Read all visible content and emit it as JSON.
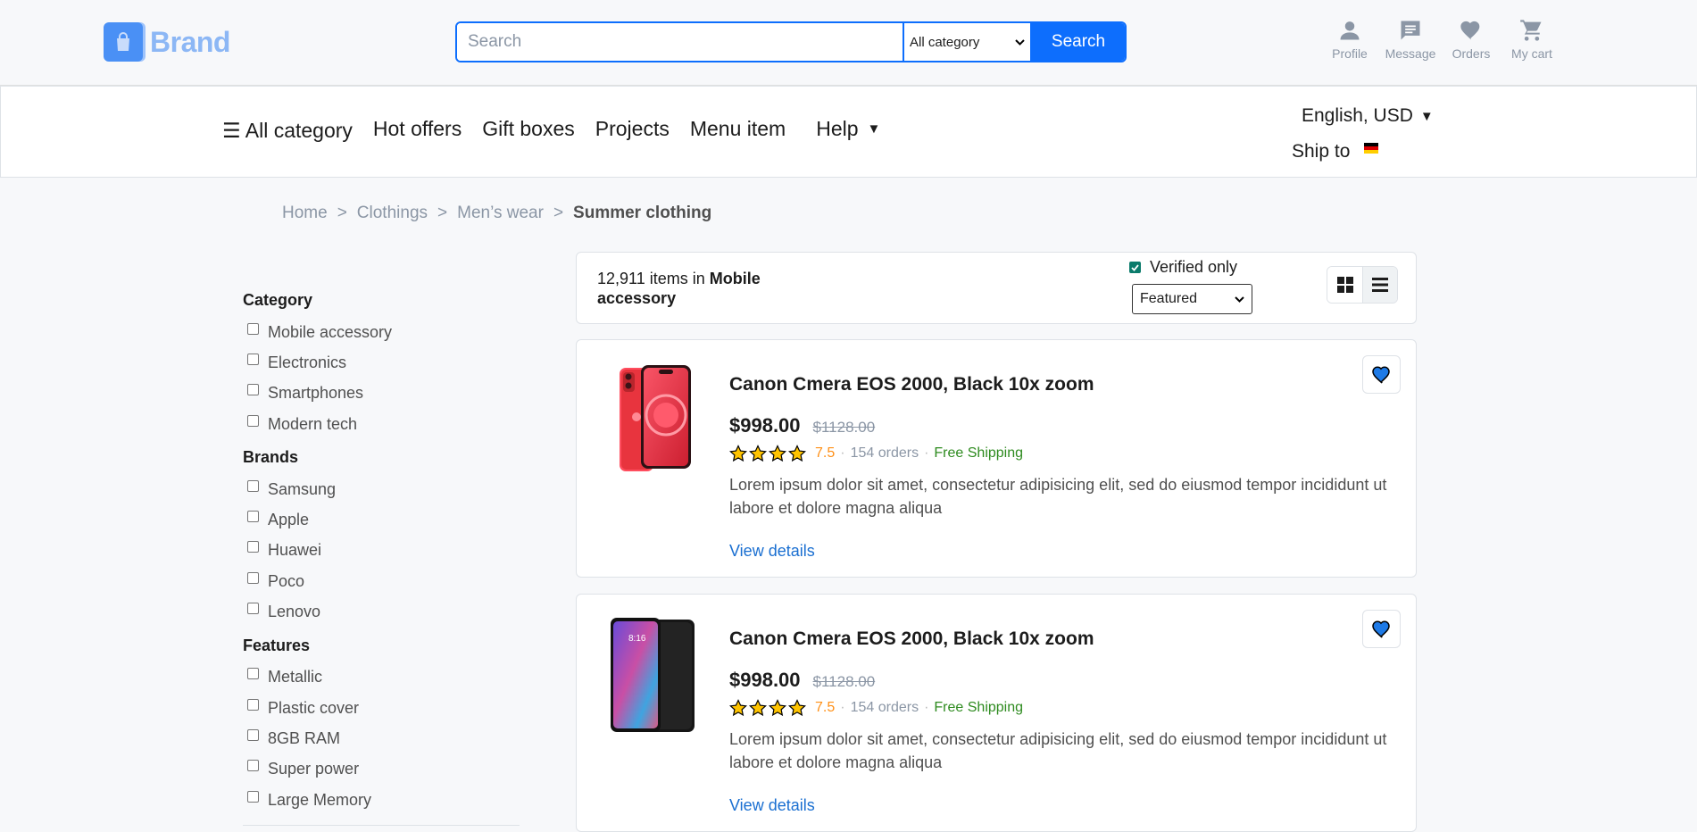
{
  "header": {
    "brand_name": "Brand",
    "search": {
      "placeholder": "Search",
      "category_selected": "All category",
      "button_label": "Search"
    },
    "actions": [
      {
        "label": "Profile",
        "icon": "person-icon"
      },
      {
        "label": "Message",
        "icon": "message-icon"
      },
      {
        "label": "Orders",
        "icon": "heart-icon"
      },
      {
        "label": "My cart",
        "icon": "cart-icon"
      }
    ]
  },
  "nav": {
    "all_category": "☰ All category",
    "items": [
      "Hot offers",
      "Gift boxes",
      "Projects",
      "Menu item"
    ],
    "help": "Help",
    "language": "English, USD",
    "ship_to": "Ship to"
  },
  "breadcrumb": {
    "items": [
      "Home",
      "Clothings",
      "Men’s wear"
    ],
    "current": "Summer clothing",
    "separator": ">"
  },
  "filters": [
    {
      "title": "Category",
      "options": [
        "Mobile accessory",
        "Electronics",
        "Smartphones",
        "Modern tech"
      ]
    },
    {
      "title": "Brands",
      "options": [
        "Samsung",
        "Apple",
        "Huawei",
        "Poco",
        "Lenovo"
      ]
    },
    {
      "title": "Features",
      "options": [
        "Metallic",
        "Plastic cover",
        "8GB RAM",
        "Super power",
        "Large Memory"
      ]
    }
  ],
  "results": {
    "count_text": "12,911 items in",
    "category": "Mobile accessory",
    "verified_label": "Verified only",
    "sort_selected": "Featured"
  },
  "products": [
    {
      "title": "Canon Cmera EOS 2000, Black 10x zoom",
      "price": "$998.00",
      "old_price": "$1128.00",
      "rating": "7.5",
      "orders": "154 orders",
      "shipping": "Free Shipping",
      "description": "Lorem ipsum dolor sit amet, consectetur adipisicing elit, sed do eiusmod tempor incididunt ut labore et dolore magna aliqua",
      "link": "View details"
    },
    {
      "title": "Canon Cmera EOS 2000, Black 10x zoom",
      "price": "$998.00",
      "old_price": "$1128.00",
      "rating": "7.5",
      "orders": "154 orders",
      "shipping": "Free Shipping",
      "description": "Lorem ipsum dolor sit amet, consectetur adipisicing elit, sed do eiusmod tempor incididunt ut labore et dolore magna aliqua",
      "link": "View details",
      "phone_time": "8:16"
    }
  ],
  "colors": {
    "primary": "#0d6efd",
    "rating": "#ff9017",
    "shipping": "#2e8b1f",
    "muted": "#8b96a5"
  }
}
